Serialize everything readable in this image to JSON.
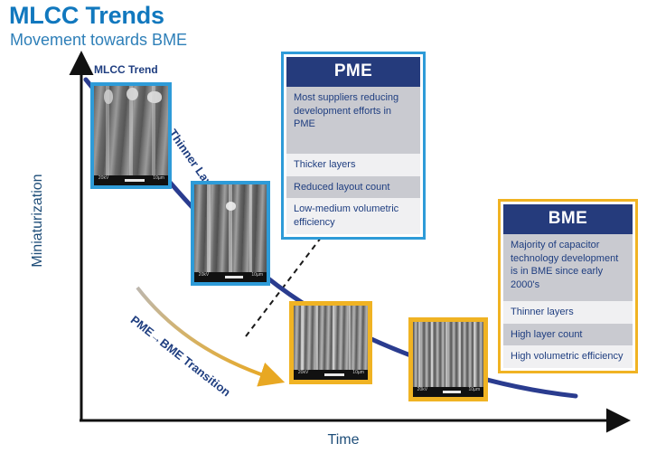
{
  "page": {
    "title": "MLCC Trends",
    "subtitle": "Movement towards  BME"
  },
  "chart_data": {
    "type": "line",
    "title": "MLCC Trends",
    "subtitle": "Movement towards BME",
    "xlabel": "Time",
    "ylabel": "Miniaturization",
    "grid": false,
    "legend": "none",
    "annotations": [
      "MLCC Trend",
      "Thinner Layers",
      "PME→BME Transition"
    ],
    "series": [
      {
        "name": "MLCC Trend",
        "color": "#2A3C8F",
        "style": "solid",
        "description": "Decaying curve from high miniaturization at early time to flat plateau at late time",
        "points": [
          [
            0.02,
            1.0
          ],
          [
            0.18,
            0.78
          ],
          [
            0.36,
            0.55
          ],
          [
            0.52,
            0.38
          ],
          [
            0.7,
            0.26
          ],
          [
            0.85,
            0.19
          ],
          [
            1.0,
            0.16
          ]
        ]
      },
      {
        "name": "PME→BME Transition",
        "color": "#E8A823",
        "style": "solid-arrow",
        "description": "Gradient grey-to-gold arrow crossing from PME region to BME region",
        "points": [
          [
            0.14,
            0.5
          ],
          [
            0.3,
            0.34
          ],
          [
            0.46,
            0.21
          ],
          [
            0.58,
            0.13
          ]
        ]
      },
      {
        "name": "PME / BME divider",
        "color": "#111111",
        "style": "dashed",
        "description": "Dashed diagonal boundary separating PME era from BME era",
        "points": [
          [
            0.32,
            0.1
          ],
          [
            0.45,
            0.4
          ]
        ]
      }
    ]
  },
  "axes": {
    "y_label": "Miniaturization",
    "x_label": "Time"
  },
  "labels": {
    "mlcc_trend": "MLCC Trend",
    "thinner_layers": "Thinner Layers",
    "transition": "PME→BME Transition"
  },
  "micrographs": [
    {
      "name": "mlcc-micrograph-1",
      "border_color": "#2E9BD8",
      "scale_left": "20kV",
      "scale_right": "10µm"
    },
    {
      "name": "mlcc-micrograph-2",
      "border_color": "#2E9BD8",
      "scale_left": "20kV",
      "scale_right": "10µm"
    },
    {
      "name": "mlcc-micrograph-3",
      "border_color": "#F0B323",
      "scale_left": "20kV",
      "scale_right": "10µm"
    },
    {
      "name": "mlcc-micrograph-4",
      "border_color": "#F0B323",
      "scale_left": "20kV",
      "scale_right": "10µm"
    }
  ],
  "cards": {
    "pme": {
      "heading": "PME",
      "border_color": "#2E9BD8",
      "header_color": "#253B7C",
      "rows": [
        "Most suppliers reducing development efforts in PME",
        "Thicker layers",
        "Reduced layout count",
        "Low-medium volumetric efficiency"
      ]
    },
    "bme": {
      "heading": "BME",
      "border_color": "#F0B323",
      "header_color": "#253B7C",
      "rows": [
        "Majority of capacitor technology development is in BME since early 2000's",
        "Thinner layers",
        "High layer count",
        "High volumetric efficiency"
      ]
    }
  },
  "colors": {
    "title_blue": "#1178BE",
    "subtitle_blue": "#2E7FB8",
    "navy": "#253B7C",
    "trend_curve": "#2A3C8F",
    "accent_blue": "#2E9BD8",
    "accent_gold": "#F0B323",
    "arrow_gold": "#E8A823",
    "row_dark": "#C9CAD0",
    "row_light": "#F0F0F2"
  }
}
